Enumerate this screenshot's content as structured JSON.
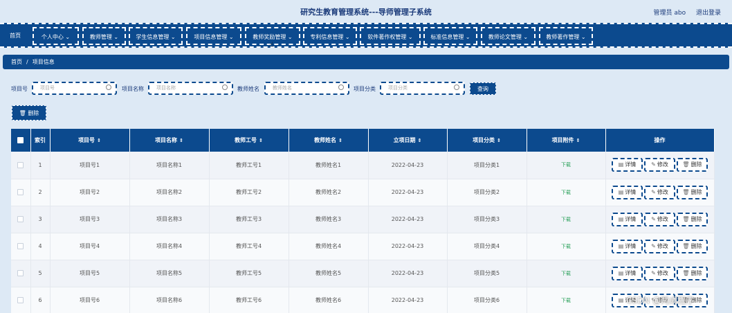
{
  "header": {
    "title": "研究生教育管理系统---导师管理子系统",
    "user": "管理员 abo",
    "logout": "退出登录"
  },
  "nav": [
    "首页",
    "个人中心",
    "教师管理",
    "学生信息管理",
    "项目信息管理",
    "教师奖励管理",
    "专利信息管理",
    "软件著作权管理",
    "标准信息管理",
    "教师论文管理",
    "教师著作管理"
  ],
  "breadcrumb": {
    "home": "首页",
    "sep": "/",
    "current": "项目信息"
  },
  "search": {
    "fields": [
      {
        "label": "项目号",
        "placeholder": "项目号"
      },
      {
        "label": "项目名称",
        "placeholder": "项目名称"
      },
      {
        "label": "教师姓名",
        "placeholder": "教师姓名"
      },
      {
        "label": "项目分类",
        "placeholder": "项目分类"
      }
    ],
    "query_label": "查询"
  },
  "toolbar": {
    "delete_label": "删除"
  },
  "table": {
    "headers": {
      "index": "索引",
      "code": "项目号",
      "name": "项目名称",
      "teacher_no": "教师工号",
      "teacher_name": "教师姓名",
      "date": "立项日期",
      "category": "项目分类",
      "attachment": "项目附件",
      "ops": "操作"
    },
    "download_label": "下载",
    "ops": {
      "detail": "详情",
      "edit": "修改",
      "delete": "删除"
    },
    "rows": [
      {
        "index": "1",
        "code": "项目号1",
        "name": "项目名称1",
        "teacher_no": "教师工号1",
        "teacher_name": "教师姓名1",
        "date": "2022-04-23",
        "category": "项目分类1"
      },
      {
        "index": "2",
        "code": "项目号2",
        "name": "项目名称2",
        "teacher_no": "教师工号2",
        "teacher_name": "教师姓名2",
        "date": "2022-04-23",
        "category": "项目分类2"
      },
      {
        "index": "3",
        "code": "项目号3",
        "name": "项目名称3",
        "teacher_no": "教师工号3",
        "teacher_name": "教师姓名3",
        "date": "2022-04-23",
        "category": "项目分类3"
      },
      {
        "index": "4",
        "code": "项目号4",
        "name": "项目名称4",
        "teacher_no": "教师工号4",
        "teacher_name": "教师姓名4",
        "date": "2022-04-23",
        "category": "项目分类4"
      },
      {
        "index": "5",
        "code": "项目号5",
        "name": "项目名称5",
        "teacher_no": "教师工号5",
        "teacher_name": "教师姓名5",
        "date": "2022-04-23",
        "category": "项目分类5"
      },
      {
        "index": "6",
        "code": "项目号6",
        "name": "项目名称6",
        "teacher_no": "教师工号6",
        "teacher_name": "教师姓名6",
        "date": "2022-04-23",
        "category": "项目分类6"
      }
    ]
  },
  "watermark": "CSDN @两成程序"
}
